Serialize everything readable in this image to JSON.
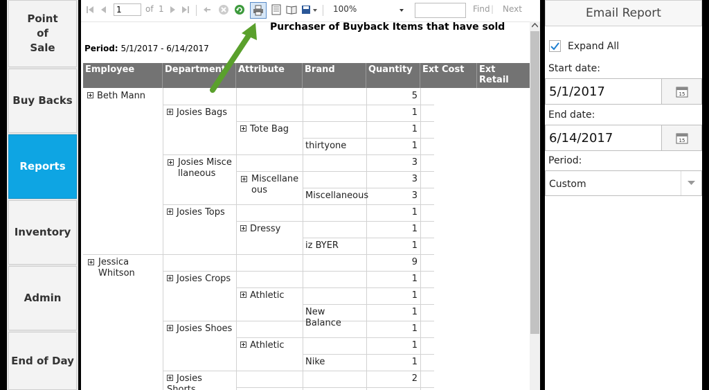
{
  "nav": {
    "items": [
      {
        "label": "Point\nof\nSale",
        "active": false
      },
      {
        "label": "Buy Backs",
        "active": false
      },
      {
        "label": "Reports",
        "active": true
      },
      {
        "label": "Inventory",
        "active": false
      },
      {
        "label": "Admin",
        "active": false
      },
      {
        "label": "End of Day",
        "active": false
      }
    ]
  },
  "toolbar": {
    "page_value": "1",
    "of_label": "of",
    "total_pages": "1",
    "zoom": "100%",
    "find_value": "",
    "find_label": "Find",
    "next_label": "Next"
  },
  "report": {
    "title": "Purchaser of Buyback Items that have sold",
    "period_label": "Period:",
    "period_value": "5/1/2017 - 6/14/2017",
    "columns": [
      "Employee",
      "Department",
      "Attribute",
      "Brand",
      "Quantity",
      "Ext Cost",
      "Ext Retail"
    ],
    "rows": {
      "r0": {
        "employee": "Beth Mann",
        "qty": "5"
      },
      "r1": {
        "department": "Josies Bags",
        "qty": "1"
      },
      "r2": {
        "attribute": "Tote Bag",
        "qty": "1"
      },
      "r3": {
        "brand": "thirtyone",
        "qty": "1"
      },
      "r4": {
        "department": "Josies Miscellaneous",
        "qty": "3"
      },
      "r5": {
        "attribute": "Miscellaneous",
        "qty": "3"
      },
      "r6": {
        "brand": "Miscellaneous",
        "qty": "3"
      },
      "r7": {
        "department": "Josies Tops",
        "qty": "1"
      },
      "r8": {
        "attribute": "Dressy",
        "qty": "1"
      },
      "r9": {
        "brand": "iz BYER",
        "qty": "1"
      },
      "r10": {
        "employee": "Jessica Whitson",
        "qty": "9"
      },
      "r11": {
        "department": "Josies Crops",
        "qty": "1"
      },
      "r12": {
        "attribute": "Athletic",
        "qty": "1"
      },
      "r13": {
        "brand": "New Balance",
        "qty": "1"
      },
      "r14": {
        "department": "Josies Shoes",
        "qty": "1"
      },
      "r15": {
        "attribute": "Athletic",
        "qty": "1"
      },
      "r16": {
        "brand": "Nike",
        "qty": "1"
      },
      "r17": {
        "department": "Josies Shorts",
        "qty": "2"
      }
    }
  },
  "panel": {
    "title": "Email Report",
    "expand_all_label": "Expand All",
    "expand_all_checked": true,
    "start_date_label": "Start date:",
    "start_date": "5/1/2017",
    "end_date_label": "End date:",
    "end_date": "6/14/2017",
    "period_label": "Period:",
    "period_value": "Custom"
  },
  "colors": {
    "accent": "#0ea5e3",
    "header_bg": "#737373",
    "arrow": "#5aa02c"
  }
}
